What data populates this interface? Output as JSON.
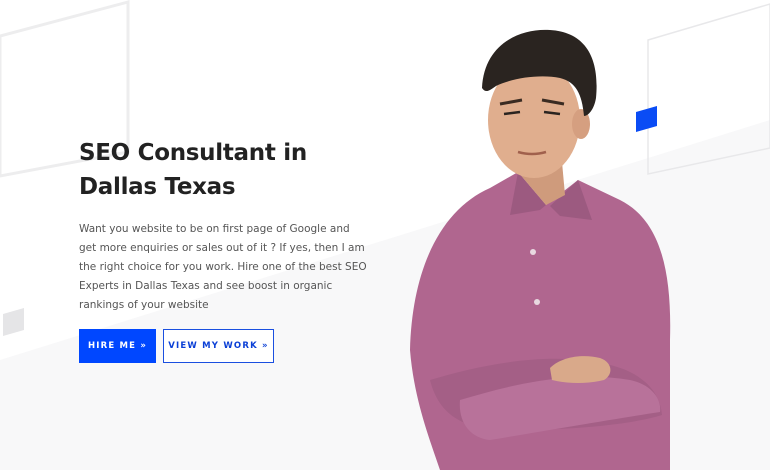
{
  "hero": {
    "headline": "SEO Consultant in Dallas Texas",
    "description": "Want you website to be on first page of Google and get more enquiries or sales out of it ? If yes, then I am the right choice for you work. Hire one of the best SEO Experts in Dallas Texas and see boost in organic rankings of your website",
    "primary_button": "HIRE ME »",
    "secondary_button": "VIEW MY WORK »"
  },
  "colors": {
    "accent": "#0047ff",
    "headline": "#222222",
    "body_text": "#555555",
    "shirt": "#b0668f"
  }
}
